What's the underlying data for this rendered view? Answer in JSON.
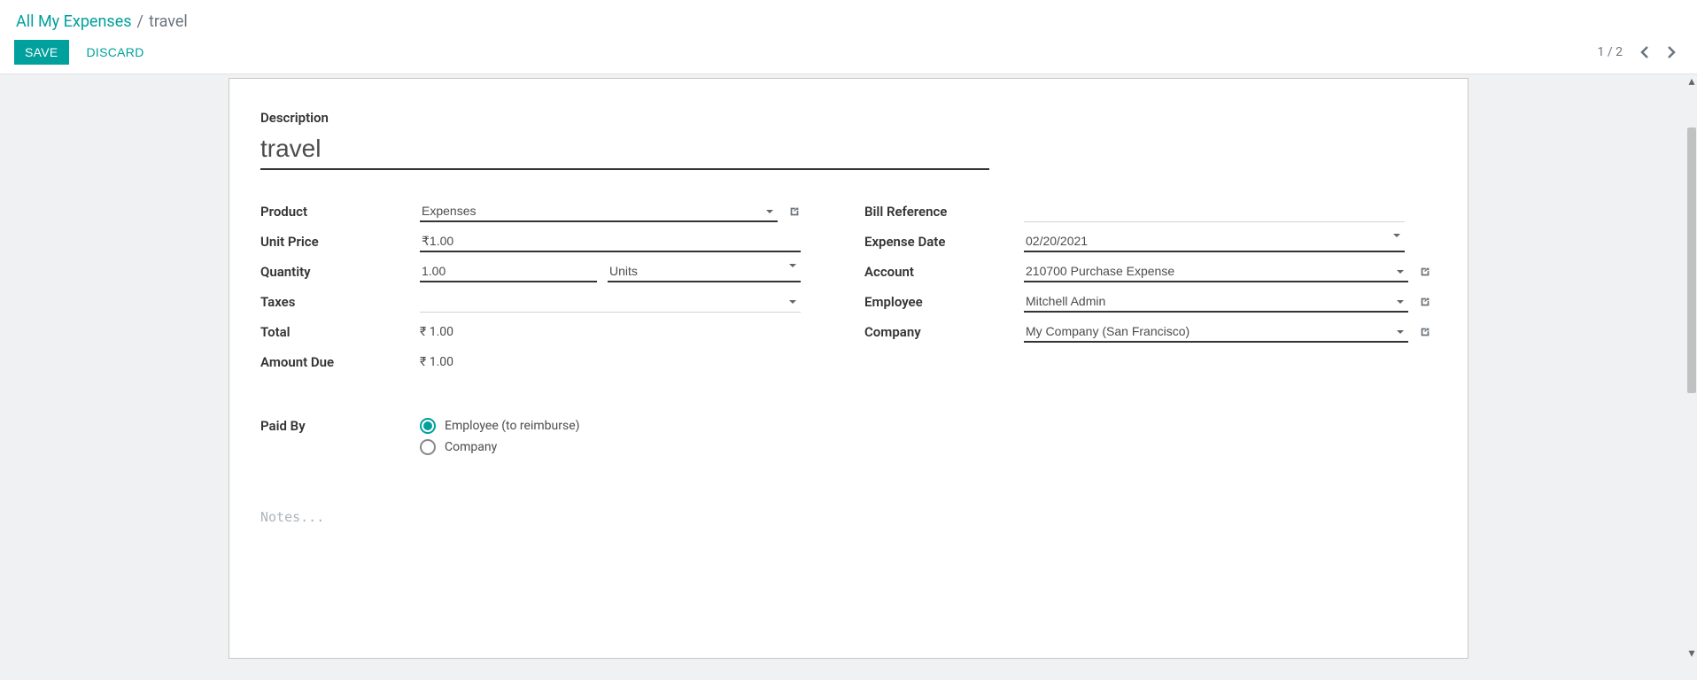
{
  "breadcrumb": {
    "root": "All My Expenses",
    "current": "travel"
  },
  "buttons": {
    "save": "SAVE",
    "discard": "DISCARD"
  },
  "pager": {
    "text": "1 / 2"
  },
  "form": {
    "description_label": "Description",
    "description": "travel",
    "left": {
      "product_label": "Product",
      "product": "Expenses",
      "unit_price_label": "Unit Price",
      "unit_price": "₹1.00",
      "quantity_label": "Quantity",
      "quantity": "1.00",
      "uom": "Units",
      "taxes_label": "Taxes",
      "taxes": "",
      "total_label": "Total",
      "total": "₹ 1.00",
      "amount_due_label": "Amount Due",
      "amount_due": "₹ 1.00",
      "paid_by_label": "Paid By",
      "paid_by_opts": {
        "employee": "Employee (to reimburse)",
        "company": "Company"
      }
    },
    "right": {
      "bill_ref_label": "Bill Reference",
      "bill_ref": "",
      "date_label": "Expense Date",
      "date": "02/20/2021",
      "account_label": "Account",
      "account": "210700 Purchase Expense",
      "employee_label": "Employee",
      "employee": "Mitchell Admin",
      "company_label": "Company",
      "company": "My Company (San Francisco)"
    },
    "notes_placeholder": "Notes..."
  }
}
